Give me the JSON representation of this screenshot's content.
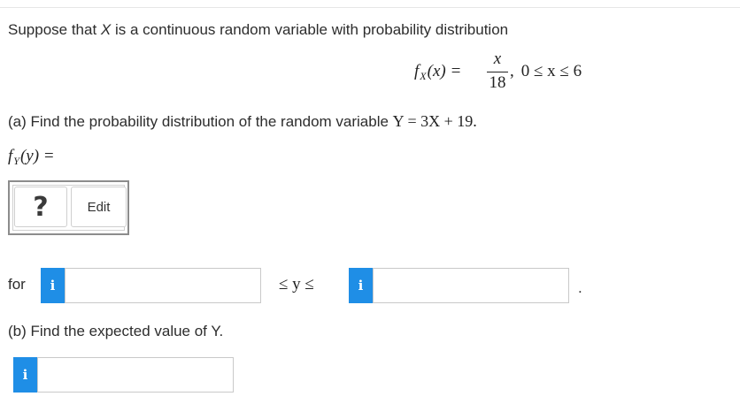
{
  "question": {
    "intro": {
      "pre": "Suppose that ",
      "var": "X",
      "post": " is a continuous random variable with probability distribution"
    },
    "pdf": {
      "lhs_f": "f",
      "lhs_sub": "X",
      "lhs_arg": "(x) =",
      "numerator": "x",
      "denominator": "18",
      "comma": ",",
      "domain": "0 ≤ x ≤ 6"
    },
    "part_a": {
      "text": "(a) Find the probability distribution of the random variable ",
      "math": "Y = 3X + 19."
    },
    "answer_label": {
      "f": "f",
      "sub": "Y",
      "rest": "(y) ="
    },
    "editor": {
      "placeholder_symbol": "?",
      "edit_label": "Edit"
    },
    "range": {
      "for_label": "for",
      "between": "≤ y ≤",
      "end": "."
    },
    "part_b": {
      "text": "(b) Find the expected value of Y."
    },
    "info_icon": "i"
  }
}
